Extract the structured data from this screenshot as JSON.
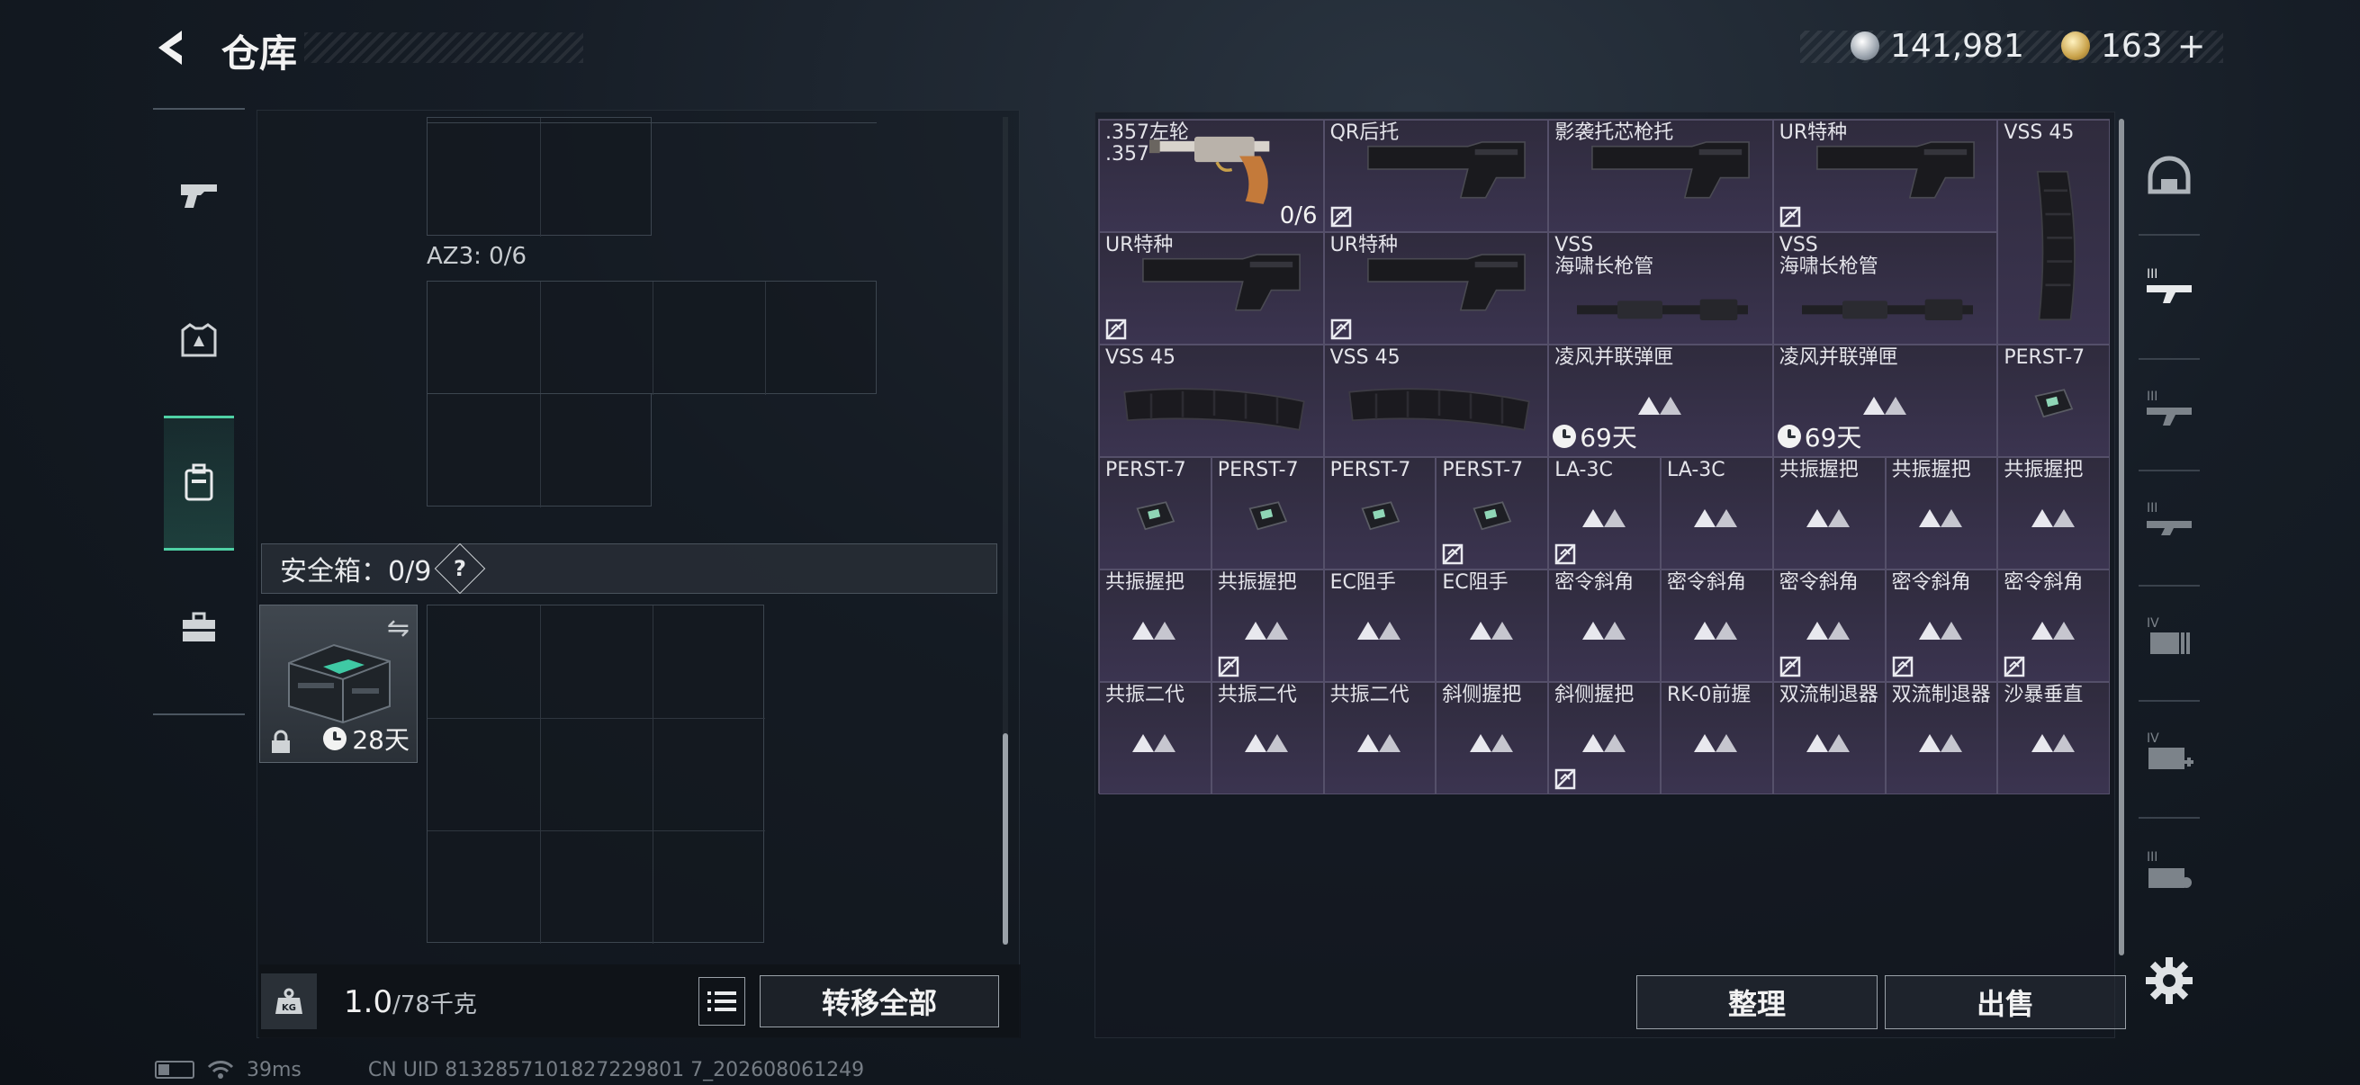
{
  "header": {
    "title": "仓库",
    "silver_amount": "141,981",
    "gold_amount": "163",
    "plus_label": "+"
  },
  "left_rail": {
    "items": [
      "pistol-icon",
      "armor-icon",
      "backpack-icon",
      "toolbox-icon"
    ],
    "active": "backpack-icon"
  },
  "backpack": {
    "az3_label": "AZ3: 0/6",
    "safe_box_label": "安全箱：0/9",
    "help_label": "?",
    "safe_item_timer": "28天",
    "weight_value": "1.0",
    "weight_unit": "/78千克",
    "kg_label": "KG",
    "transfer_all_label": "转移全部"
  },
  "stash": {
    "items": [
      {
        "name": ".357左轮\n.357",
        "count": "0/6"
      },
      {
        "name": "QR后托"
      },
      {
        "name": "影袭托芯枪托"
      },
      {
        "name": "UR特种"
      },
      {
        "name": "VSS 45"
      },
      {
        "name": "UR特种"
      },
      {
        "name": "UR特种"
      },
      {
        "name": "VSS\n海啸长枪管"
      },
      {
        "name": "VSS\n海啸长枪管"
      },
      {
        "name": "VSS 45"
      },
      {
        "name": "VSS 45"
      },
      {
        "name": "凌风并联弹匣",
        "timer": "69天"
      },
      {
        "name": "凌风并联弹匣",
        "timer": "69天"
      },
      {
        "name": "PERST-7"
      },
      {
        "name": "PERST-7"
      },
      {
        "name": "PERST-7"
      },
      {
        "name": "PERST-7"
      },
      {
        "name": "PERST-7"
      },
      {
        "name": "LA-3C"
      },
      {
        "name": "LA-3C"
      },
      {
        "name": "共振握把"
      },
      {
        "name": "共振握把"
      },
      {
        "name": "共振握把"
      },
      {
        "name": "共振握把"
      },
      {
        "name": "共振握把"
      },
      {
        "name": "EC阻手"
      },
      {
        "name": "EC阻手"
      },
      {
        "name": "密令斜角"
      },
      {
        "name": "密令斜角"
      },
      {
        "name": "密令斜角"
      },
      {
        "name": "密令斜角"
      },
      {
        "name": "密令斜角"
      },
      {
        "name": "共振二代"
      },
      {
        "name": "共振二代"
      },
      {
        "name": "共振二代"
      },
      {
        "name": "斜侧握把"
      },
      {
        "name": "斜侧握把"
      },
      {
        "name": "RK-0前握"
      },
      {
        "name": "双流制退器"
      },
      {
        "name": "双流制退器"
      },
      {
        "name": "沙暴垂直"
      }
    ],
    "sort_label": "整理",
    "sell_label": "出售"
  },
  "right_rail": {
    "items": [
      "helmet-icon",
      "rifle-tier3-icon",
      "rifle-tier3-b-icon",
      "rifle-tier3-c-icon",
      "ammo-tier4-icon",
      "medkit-tier4-icon",
      "tool-tier3-icon"
    ]
  },
  "statusbar": {
    "ping": "39ms",
    "uid": "CN UID 8132857101827229801 7_202608061249"
  }
}
